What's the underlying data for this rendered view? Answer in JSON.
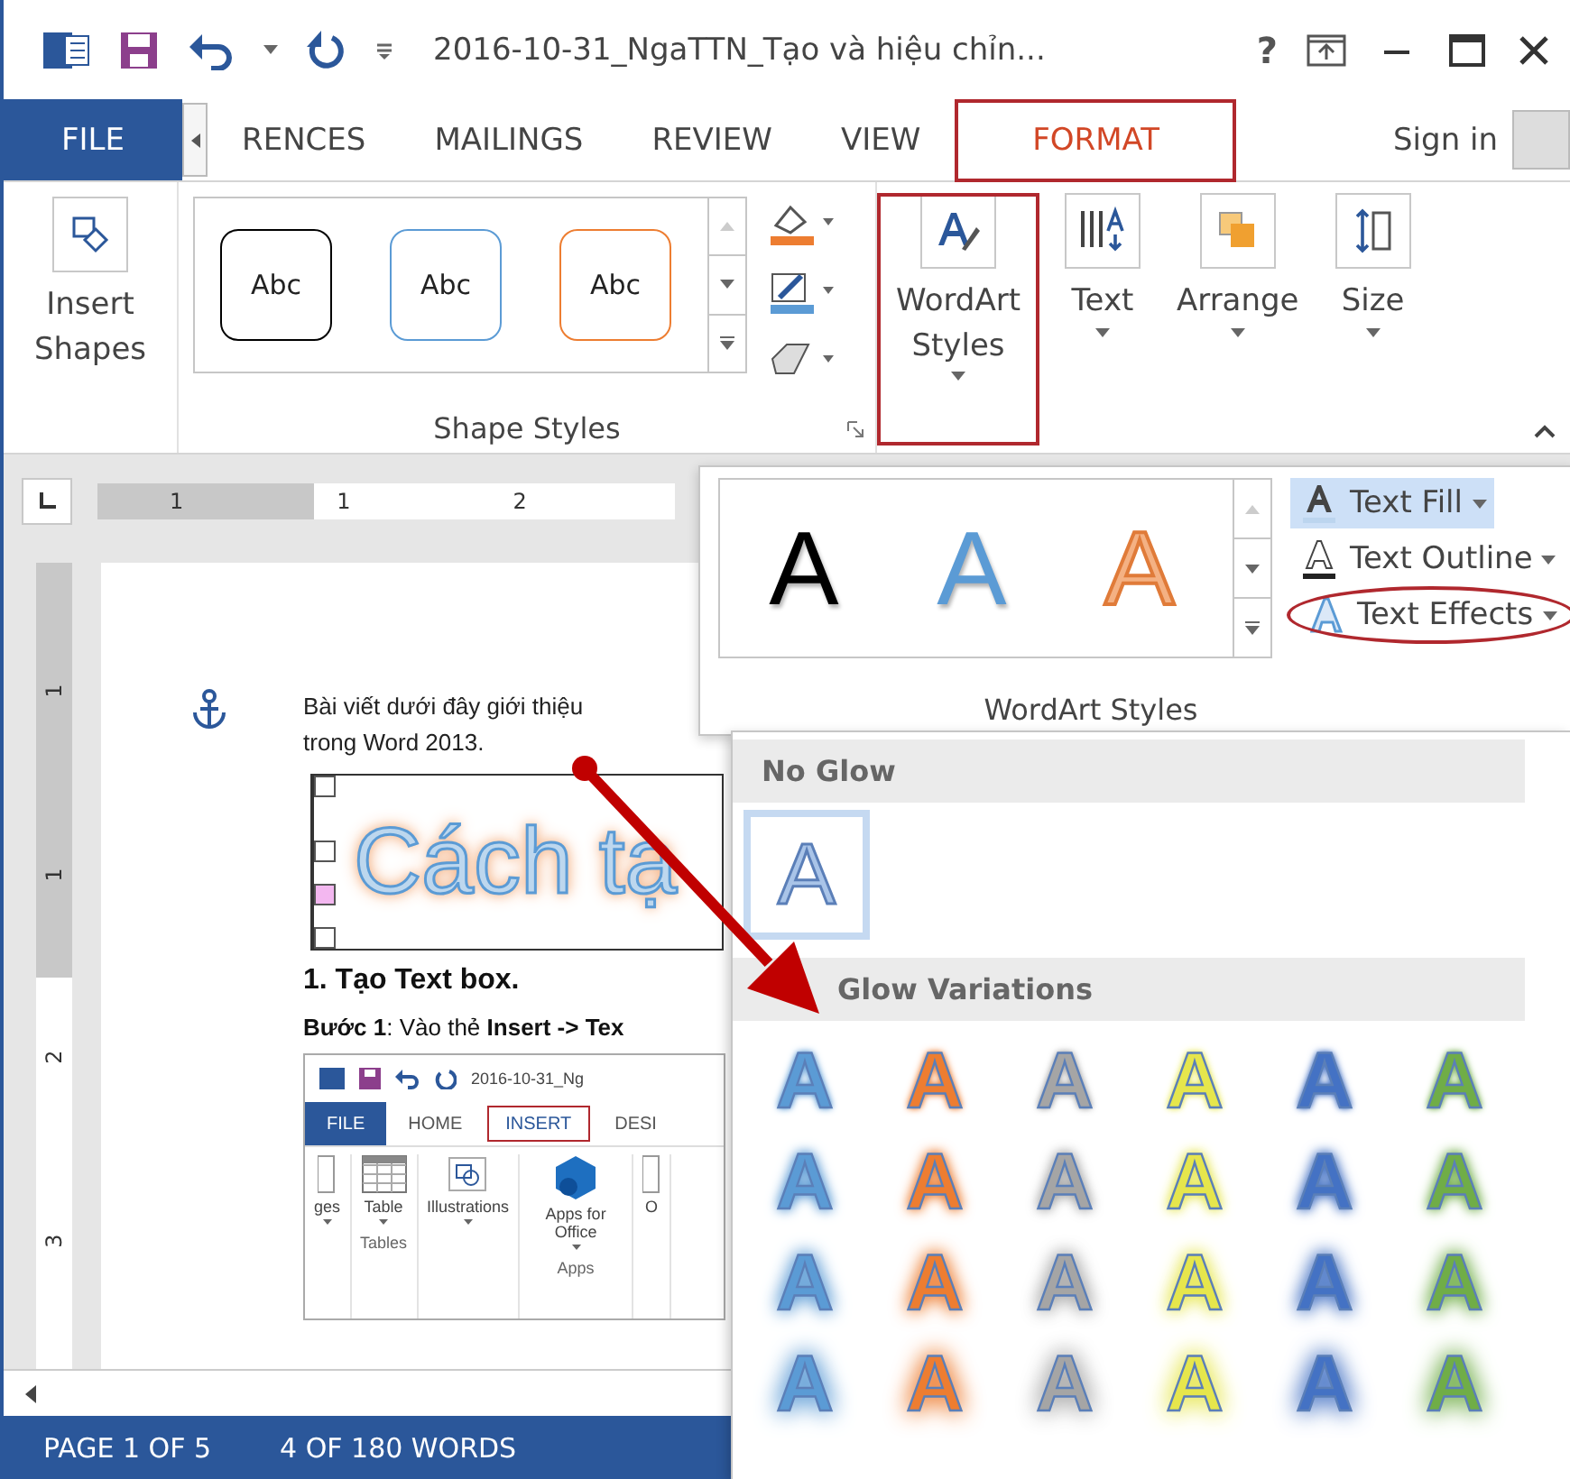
{
  "title_bar": {
    "title": "2016-10-31_NgaTTN_Tạo và hiệu chỉn...",
    "help": "?"
  },
  "tabs": [
    {
      "label": "FILE",
      "kind": "file",
      "selected": false,
      "highlighted": false
    },
    {
      "label": "RENCES",
      "kind": "tab",
      "selected": false,
      "highlighted": false
    },
    {
      "label": "MAILINGS",
      "kind": "tab",
      "selected": false,
      "highlighted": false
    },
    {
      "label": "REVIEW",
      "kind": "tab",
      "selected": false,
      "highlighted": false
    },
    {
      "label": "VIEW",
      "kind": "tab",
      "selected": false,
      "highlighted": false
    },
    {
      "label": "FORMAT",
      "kind": "tab",
      "selected": true,
      "highlighted": true
    }
  ],
  "sign_in": "Sign in",
  "ribbon": {
    "insert_shapes": "Insert Shapes",
    "shape_samples": [
      {
        "label": "Abc",
        "color": "#000000"
      },
      {
        "label": "Abc",
        "color": "#5b9bd5"
      },
      {
        "label": "Abc",
        "color": "#ed7d31"
      }
    ],
    "shape_styles_label": "Shape Styles",
    "buttons": [
      {
        "label": "WordArt Styles",
        "kind": "wordart",
        "highlighted": true
      },
      {
        "label": "Text",
        "kind": "text",
        "highlighted": false
      },
      {
        "label": "Arrange",
        "kind": "arrange",
        "highlighted": false
      },
      {
        "label": "Size",
        "kind": "size",
        "highlighted": false
      }
    ]
  },
  "ruler": {
    "h_numbers": [
      "1",
      "1",
      "2"
    ],
    "v_numbers": [
      "1",
      "1",
      "2",
      "3"
    ]
  },
  "document": {
    "paragraph_lines": [
      "Bài viết dưới đây giới thiệu",
      "trong Word 2013."
    ],
    "wordart_text": "Cách tạ",
    "heading": "1. Tạo Text box.",
    "step": "**Bước 1**: Vào thẻ **Insert -> Tex**",
    "screenshot": {
      "title": "2016-10-31_Ng",
      "tabs": [
        {
          "label": "FILE",
          "kind": "file",
          "highlighted": false
        },
        {
          "label": "HOME",
          "kind": "tab",
          "highlighted": false
        },
        {
          "label": "INSERT",
          "kind": "tab",
          "highlighted": true
        },
        {
          "label": "DESI",
          "kind": "tab",
          "highlighted": false
        }
      ],
      "commands": [
        {
          "label": "ges",
          "kind": "cut",
          "dropdown": true
        },
        {
          "label": "Table",
          "kind": "table",
          "group": "Tables",
          "dropdown": true
        },
        {
          "label": "Illustrations",
          "kind": "shapes",
          "dropdown": true
        },
        {
          "label": "Apps for Office",
          "kind": "apps",
          "group": "Apps",
          "dropdown": true
        },
        {
          "label": "O",
          "kind": "cut",
          "dropdown": false
        }
      ]
    }
  },
  "status_bar": {
    "page": "PAGE 1 OF 5",
    "words": "4 OF 180 WORDS"
  },
  "wordart_panel": {
    "samples": [
      {
        "label": "A",
        "kind": "solid",
        "color": "#000000"
      },
      {
        "label": "A",
        "kind": "solid",
        "color": "#5b9bd5"
      },
      {
        "label": "A",
        "kind": "outline",
        "color": "#f4b183"
      }
    ],
    "commands": [
      {
        "label": "Text Fill",
        "kind": "fill",
        "hovered": true,
        "circled": false
      },
      {
        "label": "Text Outline",
        "kind": "outline",
        "hovered": false,
        "circled": false
      },
      {
        "label": "Text Effects",
        "kind": "effects",
        "hovered": false,
        "circled": true
      }
    ],
    "group_label": "WordArt Styles"
  },
  "glow_menu": {
    "no_glow_header": "No Glow",
    "no_glow_sample": {
      "label": "A",
      "selected": true
    },
    "variations_header": "Glow Variations",
    "rows": [
      {
        "items": [
          {
            "label": "A",
            "color": "#5b9bd5"
          },
          {
            "label": "A",
            "color": "#ed7d31"
          },
          {
            "label": "A",
            "color": "#a5a5a5"
          },
          {
            "label": "A",
            "color": "#e6e64c"
          },
          {
            "label": "A",
            "color": "#4472c4"
          },
          {
            "label": "A",
            "color": "#70ad47"
          }
        ]
      },
      {
        "items": [
          {
            "label": "A",
            "color": "#5b9bd5"
          },
          {
            "label": "A",
            "color": "#ed7d31"
          },
          {
            "label": "A",
            "color": "#a5a5a5"
          },
          {
            "label": "A",
            "color": "#e6e64c"
          },
          {
            "label": "A",
            "color": "#4472c4"
          },
          {
            "label": "A",
            "color": "#70ad47"
          }
        ]
      },
      {
        "items": [
          {
            "label": "A",
            "color": "#5b9bd5"
          },
          {
            "label": "A",
            "color": "#ed7d31"
          },
          {
            "label": "A",
            "color": "#a5a5a5"
          },
          {
            "label": "A",
            "color": "#e6e64c"
          },
          {
            "label": "A",
            "color": "#4472c4"
          },
          {
            "label": "A",
            "color": "#70ad47"
          }
        ]
      },
      {
        "items": [
          {
            "label": "A",
            "color": "#5b9bd5"
          },
          {
            "label": "A",
            "color": "#ed7d31"
          },
          {
            "label": "A",
            "color": "#a5a5a5"
          },
          {
            "label": "A",
            "color": "#e6e64c"
          },
          {
            "label": "A",
            "color": "#4472c4"
          },
          {
            "label": "A",
            "color": "#70ad47"
          }
        ]
      }
    ]
  }
}
